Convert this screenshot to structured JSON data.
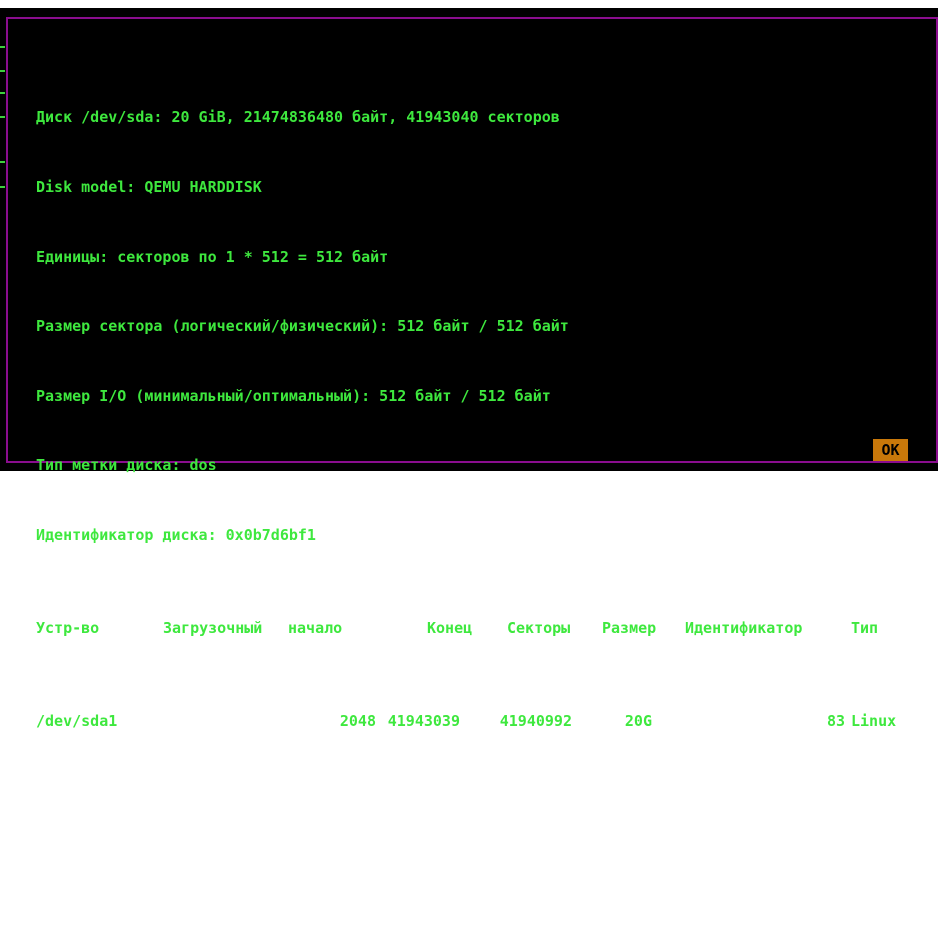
{
  "disk_info": {
    "line1": "Диск /dev/sda: 20 GiB, 21474836480 байт, 41943040 секторов",
    "line2": "Disk model: QEMU HARDDISK",
    "line3": "Единицы: секторов по 1 * 512 = 512 байт",
    "line4": "Размер сектора (логический/физический): 512 байт / 512 байт",
    "line5": "Размер I/O (минимальный/оптимальный): 512 байт / 512 байт",
    "line6": "Тип метки диска: dos",
    "line7": "Идентификатор диска: 0x0b7d6bf1"
  },
  "partition_table": {
    "headers": {
      "device": "Устр-во",
      "boot": "Загрузочный",
      "start": "начало",
      "end": "Конец",
      "sectors": "Секторы",
      "size": "Размер",
      "id": "Идентификатор",
      "type": "Тип"
    },
    "rows": [
      {
        "device": "/dev/sda1",
        "boot": "",
        "start": "2048",
        "end": "41943039",
        "sectors": "41940992",
        "size": "20G",
        "id": "83",
        "type": "Linux"
      }
    ]
  },
  "buttons": {
    "ok_label": "OK"
  },
  "colors": {
    "text": "#3ee83e",
    "background": "#000000",
    "border": "#8a0d8e",
    "button": "#c8780a"
  }
}
